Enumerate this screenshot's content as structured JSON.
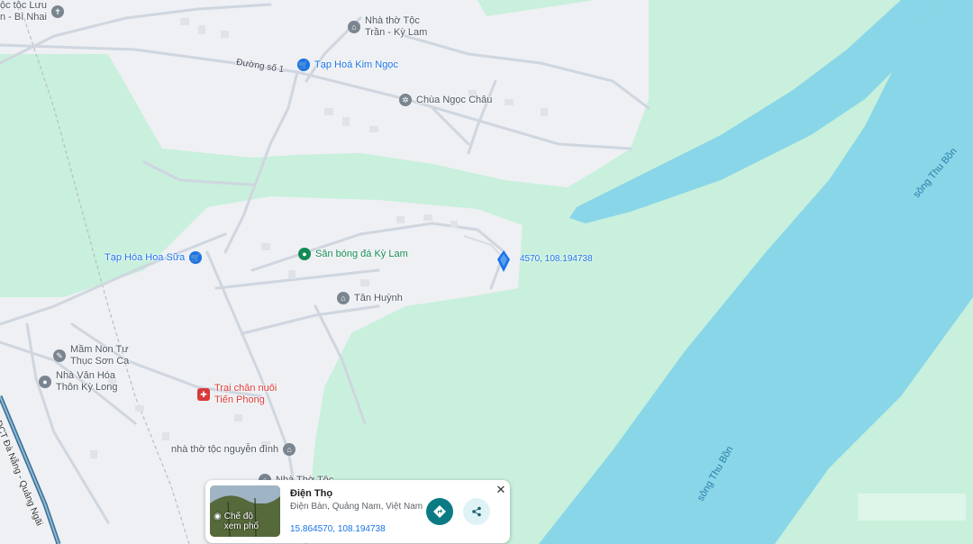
{
  "map": {
    "colors": {
      "land": "#c8f0dc",
      "urban": "#eef0f3",
      "road": "#cfd6df",
      "river": "#89d6e8",
      "railway": "#b8bec6"
    },
    "rivers": [
      {
        "label": "sông Thu Bồn"
      },
      {
        "label": "sông Thu Bồn"
      }
    ],
    "roads": [
      {
        "label": "Đường số 1"
      },
      {
        "label": "ĐCT Đà Nẵng - Quảng Ngãi"
      }
    ],
    "pois": [
      {
        "name": "Nhà thờ Tộc\nTrần - Kỳ Lam",
        "icon": "building-icon",
        "style": "gray"
      },
      {
        "name": "Tạp Hoá Kim Ngọc",
        "icon": "shopping-cart-icon",
        "style": "blue"
      },
      {
        "name": "Chùa Ngọc Châu",
        "icon": "temple-icon",
        "style": "gray"
      },
      {
        "name": "Tạp Hóa Hoa Sữa",
        "icon": "shopping-cart-icon",
        "style": "blue"
      },
      {
        "name": "Sân bóng đá Kỳ Lam",
        "icon": "sports-icon",
        "style": "green"
      },
      {
        "name": "Tân Huỳnh",
        "icon": "building-icon",
        "style": "gray"
      },
      {
        "name": "Mầm Non Tư\nThục Sơn Ca",
        "icon": "school-icon",
        "style": "gray"
      },
      {
        "name": "Nhà Văn Hóa\nThôn Kỳ Long",
        "icon": "landmark-icon",
        "style": "gray"
      },
      {
        "name": "Trại chăn nuôi\nTiến Phong",
        "icon": "farm-icon",
        "style": "red"
      },
      {
        "name": "nhà thờ tộc nguyễn đình",
        "icon": "building-icon",
        "style": "gray"
      },
      {
        "name": "Nhà Thờ Tộc",
        "icon": "building-icon",
        "style": "gray"
      },
      {
        "name": "ộc tộc Lưu\nn - Bì Nhai",
        "icon": "cross-icon",
        "style": "gray"
      }
    ],
    "dropped_pin": {
      "coords_label": "15.864570, 108.194738",
      "visible_label": "4570, 108.194738"
    }
  },
  "place_card": {
    "title": "Điện Thọ",
    "subtitle": "Điện Bàn, Quảng Nam, Việt Nam",
    "coords": "15.864570, 108.194738",
    "thumbnail_label": "Chế độ\nxem phố",
    "thumbnail_icon": "street-view-icon",
    "directions_icon": "directions-icon",
    "share_icon": "share-icon",
    "close_icon": "close-icon"
  }
}
